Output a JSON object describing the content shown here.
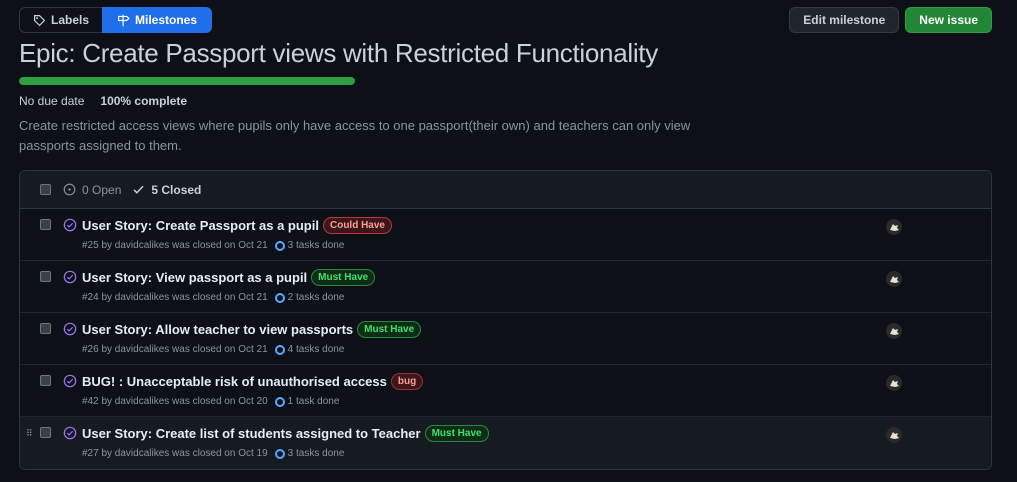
{
  "toolbar": {
    "labels_label": "Labels",
    "milestones_label": "Milestones",
    "edit_milestone_label": "Edit milestone",
    "new_issue_label": "New issue"
  },
  "milestone": {
    "title": "Epic: Create Passport views with Restricted Functionality",
    "progress_percent": 100,
    "due": "No due date",
    "complete": "100% complete",
    "description": "Create restricted access views where pupils only have access to one passport(their own) and teachers can only view passports assigned to them."
  },
  "filter": {
    "open_label": "0 Open",
    "closed_label": "5 Closed"
  },
  "issues": [
    {
      "title": "User Story: Create Passport as a pupil",
      "label": "Could Have",
      "meta": "#25 by davidcalikes was closed on Oct 21",
      "tasks": "3 tasks done"
    },
    {
      "title": "User Story: View passport as a pupil",
      "label": "Must Have",
      "meta": "#24 by davidcalikes was closed on Oct 21",
      "tasks": "2 tasks done"
    },
    {
      "title": "User Story: Allow teacher to view passports",
      "label": "Must Have",
      "meta": "#26 by davidcalikes was closed on Oct 21",
      "tasks": "4 tasks done"
    },
    {
      "title": "BUG! : Unacceptable risk of unauthorised access",
      "label": "bug",
      "meta": "#42 by davidcalikes was closed on Oct 20",
      "tasks": "1 task done"
    },
    {
      "title": "User Story: Create list of students assigned to Teacher",
      "label": "Must Have",
      "meta": "#27 by davidcalikes was closed on Oct 19",
      "tasks": "3 tasks done"
    }
  ],
  "colors": {
    "accent_blue": "#1f6feb",
    "green": "#238636",
    "closed_purple": "#a371f7"
  }
}
